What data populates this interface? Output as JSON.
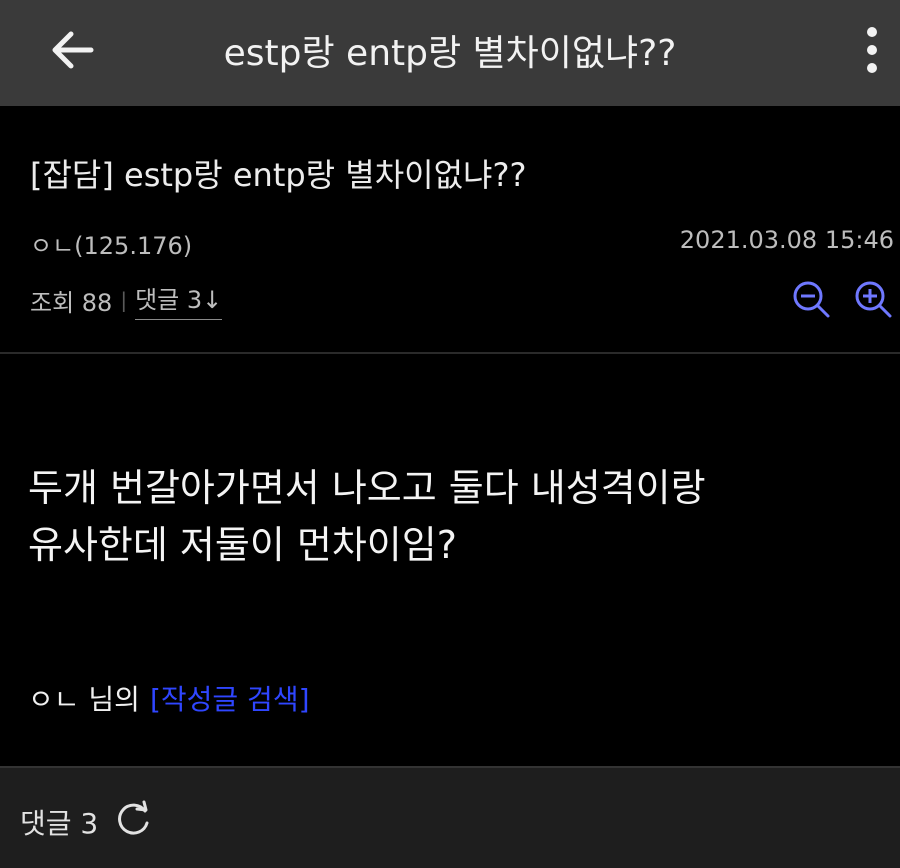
{
  "header": {
    "title": "estp랑 entp랑 별차이없냐??",
    "back_icon": "arrow-left-icon",
    "more_icon": "more-vertical-icon"
  },
  "post": {
    "title": "[잡담] estp랑 entp랑 별차이없냐??",
    "author": "ㅇㄴ(125.176)",
    "date": "2021.03.08 15:46",
    "views_label": "조회 88",
    "comments_label": "댓글 3↓",
    "body_lines": [
      "두개 번갈아가면서 나오고 둘다 내성격이랑",
      "유사한데 저둘이 먼차이임?"
    ],
    "author_search_prefix": "ㅇㄴ 님의",
    "author_search_link": "[작성글 검색]"
  },
  "footer": {
    "comments_count": "댓글 3",
    "refresh_icon": "refresh-icon"
  },
  "colors": {
    "topbar": "#3a3a3a",
    "background": "#000000",
    "link_blue": "#2f46ff",
    "zoom_icons": "#6f78ff"
  }
}
